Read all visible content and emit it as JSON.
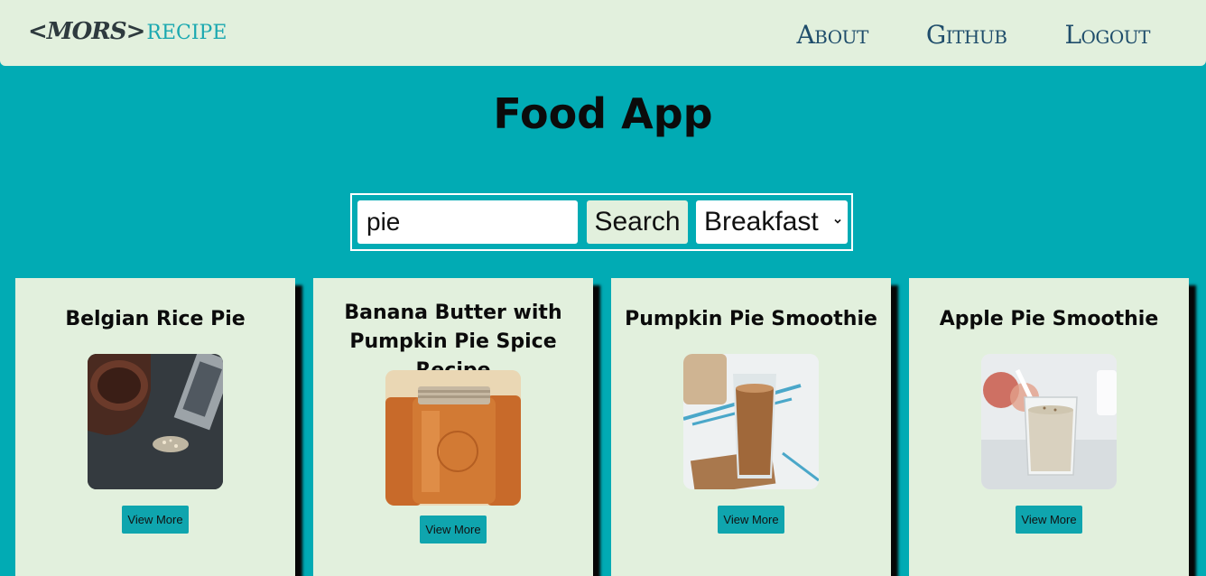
{
  "navbar": {
    "logo_mors": "<MORS>",
    "logo_recipe": "RECIPE",
    "links": [
      "About",
      "Github",
      "Logout"
    ]
  },
  "page_title": "Food App",
  "search": {
    "value": "pie",
    "button_label": "Search",
    "meal_type": "Breakfast"
  },
  "cards": [
    {
      "title": "Belgian Rice Pie",
      "button": "View More",
      "image": "rice-pie-photo"
    },
    {
      "title": "Banana Butter with Pumpkin Pie Spice Recipe",
      "button": "View More",
      "image": "banana-butter-jars-photo"
    },
    {
      "title": "Pumpkin Pie Smoothie",
      "button": "View More",
      "image": "pumpkin-smoothie-photo"
    },
    {
      "title": "Apple Pie Smoothie",
      "button": "View More",
      "image": "apple-smoothie-photo"
    }
  ],
  "colors": {
    "background": "#01abb4",
    "panel": "#e2f0dd",
    "nav_text": "#1f4d6b",
    "accent": "#0fa5ae"
  }
}
